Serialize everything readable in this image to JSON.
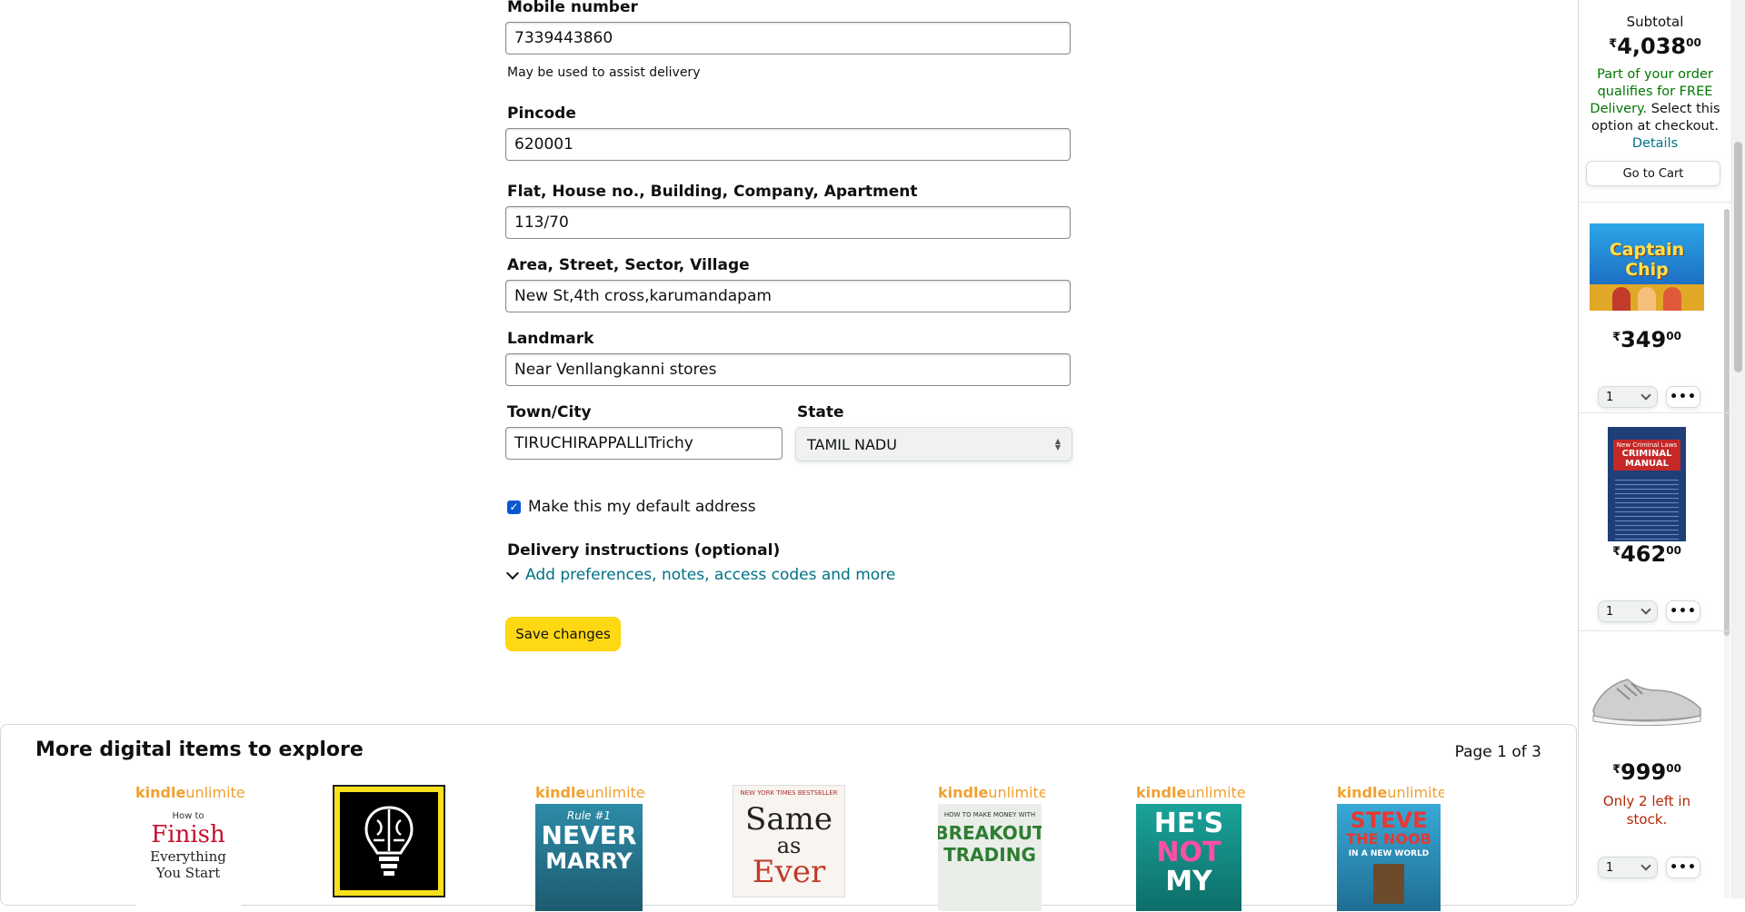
{
  "form": {
    "mobile": {
      "label": "Mobile number",
      "value": "7339443860",
      "hint": "May be used to assist delivery"
    },
    "pincode": {
      "label": "Pincode",
      "value": "620001"
    },
    "flat": {
      "label": "Flat, House no., Building, Company, Apartment",
      "value": "113/70"
    },
    "area": {
      "label": "Area, Street, Sector, Village",
      "value": "New St,4th cross,karumandapam"
    },
    "landmark": {
      "label": "Landmark",
      "value": "Near Venllangkanni stores"
    },
    "town": {
      "label": "Town/City",
      "value": "TIRUCHIRAPPALLITrichy"
    },
    "state": {
      "label": "State",
      "value": "TAMIL NADU"
    },
    "default_address": {
      "label": "Make this my default address",
      "checked": true
    },
    "delivery": {
      "title": "Delivery instructions (optional)",
      "link": "Add preferences, notes, access codes and more"
    },
    "save_label": "Save changes"
  },
  "explore": {
    "title": "More digital items to explore",
    "page": "Page 1 of 3",
    "books": [
      {
        "ku": true,
        "lines": [
          "How to",
          "Finish",
          "Everything",
          "You Start"
        ]
      },
      {
        "ku": false,
        "lines": []
      },
      {
        "ku": true,
        "lines": [
          "Rule #1",
          "NEVER",
          "MARRY"
        ]
      },
      {
        "ku": false,
        "lines": [
          "Same",
          "as",
          "Ever"
        ]
      },
      {
        "ku": true,
        "lines": [
          "HOW TO MAKE MONEY WITH",
          "BREAKOUT",
          "TRADING"
        ]
      },
      {
        "ku": true,
        "lines": [
          "HE'S",
          "NOT",
          "MY"
        ]
      },
      {
        "ku": true,
        "lines": [
          "STEVE",
          "THE NOOB",
          "IN A NEW WORLD"
        ]
      }
    ],
    "ku_brand": {
      "k": "kindle",
      "u": "unlimited"
    }
  },
  "sidebar": {
    "subtotal_label": "Subtotal",
    "subtotal": {
      "symbol": "₹",
      "whole": "4,038",
      "fraction": "00"
    },
    "free_note": {
      "green": "Part of your order qualifies for FREE Delivery.",
      "rest": " Select this option at checkout.",
      "link": "Details"
    },
    "go_to_cart": "Go to Cart",
    "items": [
      {
        "title_lines": [
          "Captain Chip"
        ],
        "price": {
          "symbol": "₹",
          "whole": "349",
          "fraction": "00"
        },
        "qty": "1"
      },
      {
        "title_lines": [
          "New Criminal Laws",
          "CRIMINAL",
          "MANUAL"
        ],
        "price": {
          "symbol": "₹",
          "whole": "462",
          "fraction": "00"
        },
        "qty": "1"
      },
      {
        "title_lines": [],
        "price": {
          "symbol": "₹",
          "whole": "999",
          "fraction": "00"
        },
        "qty": "1",
        "stock": "Only 2 left in stock."
      }
    ]
  },
  "colors": {
    "link": "#007185",
    "button_yellow": "#FFD814",
    "free_green": "#007600",
    "stock_red": "#B12704"
  },
  "icons": [
    "chevron-down-icon",
    "checkmark-icon",
    "select-arrows-icon",
    "more-options-icon"
  ]
}
